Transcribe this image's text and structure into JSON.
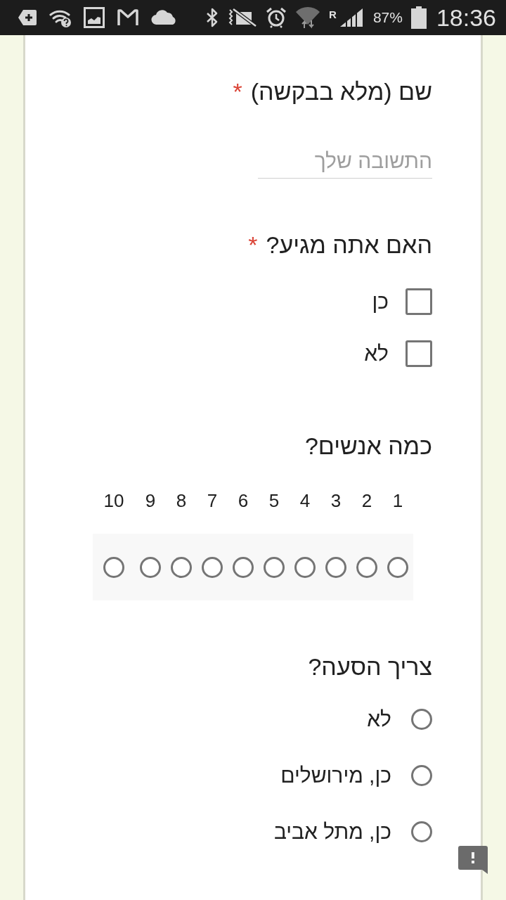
{
  "status_bar": {
    "roaming": "R",
    "battery": "87%",
    "time": "18:36"
  },
  "form": {
    "questions": [
      {
        "kind": "text",
        "title": "שם (מלא בבקשה)",
        "required_mark": "*",
        "placeholder": "התשובה שלך"
      },
      {
        "kind": "checkbox",
        "title": "האם אתה מגיע?",
        "required_mark": "*",
        "options": [
          {
            "label": "כן",
            "checked": false
          },
          {
            "label": "לא",
            "checked": false
          }
        ]
      },
      {
        "kind": "scale",
        "title": "כמה אנשים?",
        "options": [
          {
            "label": "1",
            "selected": false
          },
          {
            "label": "2",
            "selected": false
          },
          {
            "label": "3",
            "selected": false
          },
          {
            "label": "4",
            "selected": false
          },
          {
            "label": "5",
            "selected": false
          },
          {
            "label": "6",
            "selected": false
          },
          {
            "label": "7",
            "selected": false
          },
          {
            "label": "8",
            "selected": false
          },
          {
            "label": "9",
            "selected": false
          },
          {
            "label": "10",
            "selected": false
          }
        ]
      },
      {
        "kind": "radio",
        "title": "צריך הסעה?",
        "options": [
          {
            "label": "לא",
            "selected": false
          },
          {
            "label": "כן, מירושלים",
            "selected": false
          },
          {
            "label": "כן, מתל אביב",
            "selected": false
          }
        ]
      }
    ]
  }
}
